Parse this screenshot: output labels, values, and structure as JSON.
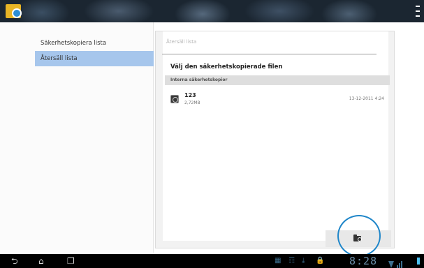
{
  "app": {
    "icon": "backup-app-icon",
    "menu_icon": "overflow-menu-icon"
  },
  "sidebar": {
    "items": [
      {
        "label": "Säkerhetskopiera lista",
        "selected": false
      },
      {
        "label": "Återsäll lista",
        "selected": true
      }
    ]
  },
  "main": {
    "header": "Återsäll lista",
    "heading": "Välj den säkerhetskopierade filen",
    "section": "Interna säkerhetskopior",
    "files": [
      {
        "name": "123",
        "size": "2,72MB",
        "date": "13-12-2011 4:24"
      }
    ],
    "action_icon": "folder-search-icon"
  },
  "statusbar": {
    "clock": "8:28",
    "nav_icons": [
      "back-icon",
      "home-icon",
      "recent-apps-icon"
    ],
    "status_icons": [
      "gallery-icon",
      "usb-icon",
      "download-icon",
      "lock-icon",
      "wifi-icon",
      "signal-icon",
      "battery-icon"
    ]
  },
  "colors": {
    "accent": "#1f86c9",
    "selected_item": "#a6c6ec",
    "actionbar": "#1b2631",
    "clock": "#6c8fa9"
  }
}
